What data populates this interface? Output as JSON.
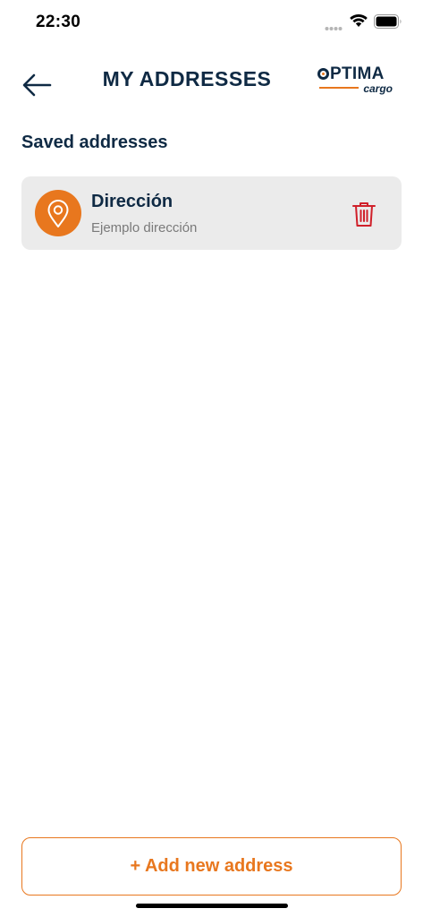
{
  "status_bar": {
    "time": "22:30"
  },
  "header": {
    "title": "MY ADDRESSES",
    "logo_main": "PTIMA",
    "logo_sub": "cargo"
  },
  "section": {
    "title": "Saved addresses"
  },
  "addresses": [
    {
      "name": "Dirección",
      "detail": "Ejemplo dirección"
    }
  ],
  "actions": {
    "add_label": "+ Add new address"
  },
  "colors": {
    "accent": "#e8771e",
    "navy": "#0f2a44",
    "delete": "#d0202a",
    "card_bg": "#ebebeb"
  },
  "icons": [
    "signal-icon",
    "wifi-icon",
    "battery-icon",
    "back-arrow-icon",
    "location-pin-icon",
    "trash-icon"
  ]
}
